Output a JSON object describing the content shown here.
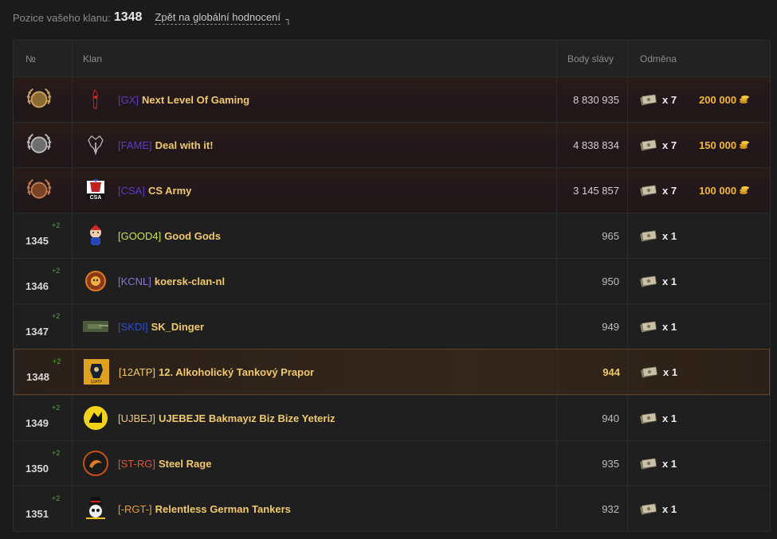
{
  "header": {
    "position_label": "Pozice vašeho klanu:",
    "position_value": "1348",
    "back_link": "Zpět na globální hodnocení"
  },
  "columns": {
    "rank": "№",
    "clan": "Klan",
    "points": "Body slávy",
    "reward": "Odměna"
  },
  "colors": {
    "accent_gold": "#f5b82e",
    "clan_name": "#f1c96a",
    "delta_green": "#4caf2a"
  },
  "rows": [
    {
      "rank": "I",
      "medal": "gold",
      "delta": "",
      "emblem": "gx-icon",
      "tag": "[GX]",
      "tag_color": "#5b3bc4",
      "name": "Next Level Of Gaming",
      "points": "8 830 935",
      "bonds": "x 7",
      "gold": "200 000"
    },
    {
      "rank": "II",
      "medal": "silver",
      "delta": "",
      "emblem": "fame-icon",
      "tag": "[FAME]",
      "tag_color": "#5b3bc4",
      "name": "Deal with it!",
      "points": "4 838 834",
      "bonds": "x 7",
      "gold": "150 000"
    },
    {
      "rank": "III",
      "medal": "bronze",
      "delta": "",
      "emblem": "csa-icon",
      "tag": "[CSA]",
      "tag_color": "#5b3bc4",
      "name": "CS Army",
      "points": "3 145 857",
      "bonds": "x 7",
      "gold": "100 000"
    },
    {
      "rank": "1345",
      "medal": "",
      "delta": "+2",
      "emblem": "good4-icon",
      "tag": "[GOOD4]",
      "tag_color": "#c8e04a",
      "name": "Good Gods",
      "points": "965",
      "bonds": "x 1",
      "gold": ""
    },
    {
      "rank": "1346",
      "medal": "",
      "delta": "+2",
      "emblem": "kcnl-icon",
      "tag": "[KCNL]",
      "tag_color": "#8a6fe0",
      "name": "koersk-clan-nl",
      "points": "950",
      "bonds": "x 1",
      "gold": ""
    },
    {
      "rank": "1347",
      "medal": "",
      "delta": "+2",
      "emblem": "skdi-icon",
      "tag": "[SKDI]",
      "tag_color": "#2a4fd0",
      "name": "SK_Dinger",
      "points": "949",
      "bonds": "x 1",
      "gold": ""
    },
    {
      "rank": "1348",
      "medal": "",
      "delta": "+2",
      "emblem": "12atp-icon",
      "tag": "[12ATP]",
      "tag_color": "#f1c96a",
      "name": "12. Alkoholický Tankový Prapor",
      "points": "944",
      "bonds": "x 1",
      "gold": ""
    },
    {
      "rank": "1349",
      "medal": "",
      "delta": "+2",
      "emblem": "ujbej-icon",
      "tag": "[UJBEJ]",
      "tag_color": "#f1c96a",
      "name": "UJEBEJE Bakmayız Biz Bize Yeteriz",
      "points": "940",
      "bonds": "x 1",
      "gold": ""
    },
    {
      "rank": "1350",
      "medal": "",
      "delta": "+2",
      "emblem": "strg-icon",
      "tag": "[ST-RG]",
      "tag_color": "#e2553a",
      "name": "Steel Rage",
      "points": "935",
      "bonds": "x 1",
      "gold": ""
    },
    {
      "rank": "1351",
      "medal": "",
      "delta": "+2",
      "emblem": "rgt-icon",
      "tag": "[-RGT-]",
      "tag_color": "#f29a2e",
      "name": "Relentless German Tankers",
      "points": "932",
      "bonds": "x 1",
      "gold": ""
    }
  ]
}
